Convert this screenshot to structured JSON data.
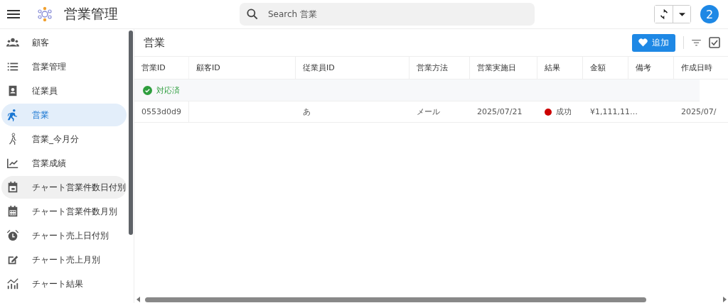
{
  "app": {
    "title": "営業管理",
    "search": {
      "placeholder": "Search 営業"
    },
    "avatar": "2"
  },
  "sidebar": {
    "items": [
      {
        "label": "顧客",
        "selected": false,
        "hovered": false
      },
      {
        "label": "営業管理",
        "selected": false,
        "hovered": false
      },
      {
        "label": "従業員",
        "selected": false,
        "hovered": false
      },
      {
        "label": "営業",
        "selected": true,
        "hovered": false
      },
      {
        "label": "営業_今月分",
        "selected": false,
        "hovered": false
      },
      {
        "label": "営業成績",
        "selected": false,
        "hovered": false
      },
      {
        "label": "チャート営業件数日付別",
        "selected": false,
        "hovered": true
      },
      {
        "label": "チャート営業件数月別",
        "selected": false,
        "hovered": false
      },
      {
        "label": "チャート売上日付別",
        "selected": false,
        "hovered": false
      },
      {
        "label": "チャート売上月別",
        "selected": false,
        "hovered": false
      },
      {
        "label": "チャート結果",
        "selected": false,
        "hovered": false
      }
    ]
  },
  "view": {
    "title": "営業",
    "add_button": "追加",
    "table": {
      "columns": [
        "営業ID",
        "顧客ID",
        "従業員ID",
        "営業方法",
        "営業実施日",
        "結果",
        "金額",
        "備考",
        "作成日時"
      ],
      "groups": [
        {
          "label": "対応済",
          "rows": [
            {
              "cells": [
                "0553d0d9",
                "",
                "あ",
                "メール",
                "2025/07/21",
                "成功",
                "¥1,111,11…",
                "",
                "2025/07/"
              ],
              "color": "#cc0000"
            }
          ]
        }
      ]
    }
  }
}
